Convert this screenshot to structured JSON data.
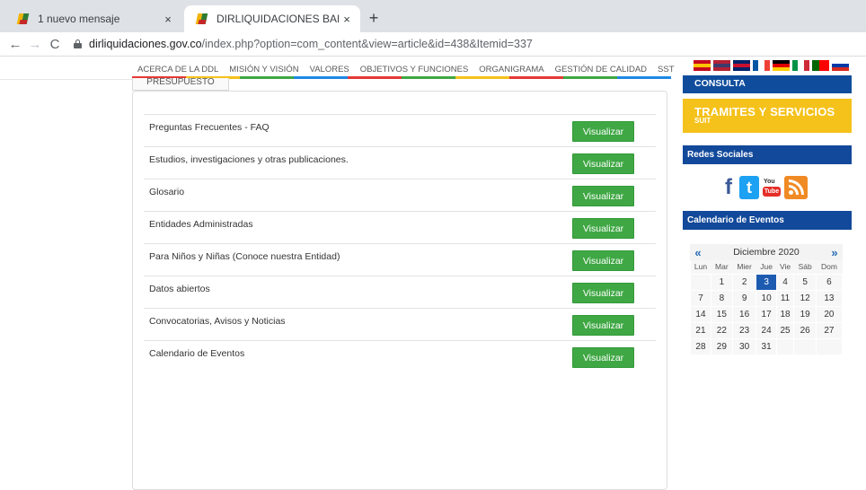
{
  "browser": {
    "tabs": [
      {
        "title": "1 nuevo mensaje",
        "close": "×",
        "active": false
      },
      {
        "title": "DIRLIQUIDACIONES BARRANQUI",
        "close": "×",
        "active": true
      }
    ],
    "new_tab": "+",
    "nav": {
      "back": "←",
      "forward": "→",
      "reload": "C"
    },
    "url_host": "dirliquidaciones.gov.co",
    "url_rest": "/index.php?option=com_content&view=article&id=438&Itemid=337"
  },
  "site_nav": {
    "menu": [
      "ACERCA DE LA DDL",
      "MISIÓN Y VISIÓN",
      "VALORES",
      "OBJETIVOS Y FUNCIONES",
      "ORGANIGRAMA",
      "GESTIÓN DE CALIDAD",
      "SST"
    ],
    "stripe_colors": [
      "#e53935",
      "#f5c21b",
      "#3fa744",
      "#1e88e5",
      "#e53935",
      "#3fa744",
      "#f5c21b",
      "#e53935",
      "#3fa744",
      "#1e88e5"
    ]
  },
  "section_tab": "PRESUPUESTO",
  "rows": [
    {
      "label": "Preguntas Frecuentes - FAQ",
      "button": "Visualizar"
    },
    {
      "label": "Estudios, investigaciones y otras publicaciones.",
      "button": "Visualizar"
    },
    {
      "label": "Glosario",
      "button": "Visualizar"
    },
    {
      "label": "Entidades Administradas",
      "button": "Visualizar"
    },
    {
      "label": "Para Niños y Niñas (Conoce nuestra Entidad)",
      "button": "Visualizar"
    },
    {
      "label": "Datos abiertos",
      "button": "Visualizar"
    },
    {
      "label": "Convocatorias, Avisos y Noticias",
      "button": "Visualizar"
    },
    {
      "label": "Calendario de Eventos",
      "button": "Visualizar"
    }
  ],
  "sidebar": {
    "consulta": "CONSULTA",
    "tramites_title": "TRAMITES Y SERVICIOS",
    "tramites_sub": "SUIT",
    "redes_title": "Redes Sociales",
    "social_icons": [
      "facebook-icon",
      "twitter-icon",
      "youtube-icon",
      "rss-icon"
    ],
    "calendar_title": "Calendario de Eventos"
  },
  "calendar": {
    "prev": "«",
    "next": "»",
    "month": "Diciembre 2020",
    "weekdays": [
      "Lun",
      "Mar",
      "Mier",
      "Jue",
      "Vie",
      "Sáb",
      "Dom"
    ],
    "weeks": [
      [
        "",
        "1",
        "2",
        "3",
        "4",
        "5",
        "6"
      ],
      [
        "7",
        "8",
        "9",
        "10",
        "11",
        "12",
        "13"
      ],
      [
        "14",
        "15",
        "16",
        "17",
        "18",
        "19",
        "20"
      ],
      [
        "21",
        "22",
        "23",
        "24",
        "25",
        "26",
        "27"
      ],
      [
        "28",
        "29",
        "30",
        "31",
        "",
        "",
        ""
      ]
    ],
    "today": "3",
    "today_color": "#1d5bb0"
  },
  "colors": {
    "button_green": "#3fa744",
    "side_blue": "#12499a",
    "tramites_yellow": "#f5c21b"
  }
}
